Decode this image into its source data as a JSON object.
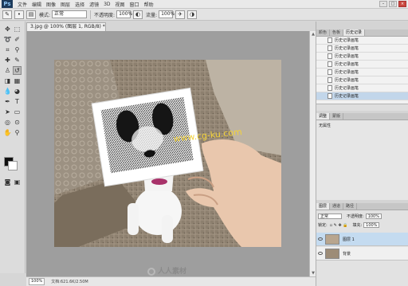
{
  "app": {
    "logo": "Ps"
  },
  "menu": [
    "文件",
    "编辑",
    "图像",
    "图层",
    "选择",
    "滤镜",
    "3D",
    "视图",
    "窗口",
    "帮助"
  ],
  "window_controls": {
    "minimize": "–",
    "maximize": "□",
    "close": "×"
  },
  "options": {
    "mode_label": "模式:",
    "mode_value": "正常",
    "opacity_label": "不透明度:",
    "opacity_value": "100%",
    "flow_label": "流量:",
    "flow_value": "100%"
  },
  "document": {
    "tab_title": "3.jpg @ 100% (图层 1, RGB/8) *",
    "zoom": "100%",
    "doc_info": "文档:621.6K/2.50M",
    "canvas_text": "www.cg-ku.com"
  },
  "history": {
    "tabs": [
      "颜色",
      "色板",
      "历史记录"
    ],
    "items": [
      "历史记录画笔",
      "历史记录画笔",
      "历史记录画笔",
      "历史记录画笔",
      "历史记录画笔",
      "历史记录画笔",
      "历史记录画笔",
      "历史记录画笔"
    ]
  },
  "middle_panel": {
    "tabs": [
      "调整",
      "蒙版"
    ],
    "text": "无属性"
  },
  "layers": {
    "tabs": [
      "图层",
      "通道",
      "路径"
    ],
    "blend_mode": "正常",
    "opacity_label": "不透明度:",
    "opacity_value": "100%",
    "lock_label": "锁定:",
    "fill_label": "填充:",
    "fill_value": "100%",
    "items": [
      {
        "name": "图层 1",
        "active": true
      },
      {
        "name": "背景",
        "active": false
      }
    ]
  },
  "watermark": {
    "text": "人人素材"
  },
  "colors": {
    "fg": "#111111",
    "bg": "#ffffff",
    "accent": "#c2d6ea"
  }
}
